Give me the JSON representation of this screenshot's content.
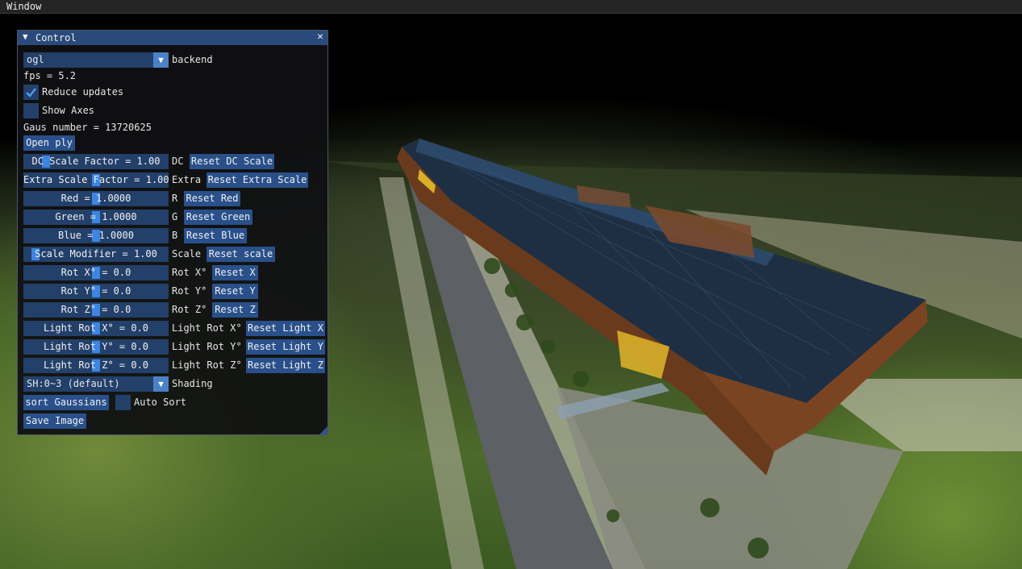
{
  "menubar": {
    "window_label": "Window"
  },
  "window": {
    "title": "Control"
  },
  "backend": {
    "selected": "ogl",
    "label": "backend"
  },
  "fps_text": "fps = 5.2",
  "reduce_updates": {
    "label": "Reduce updates",
    "checked": true
  },
  "show_axes": {
    "label": "Show Axes",
    "checked": false
  },
  "gaus_text": "Gaus number = 13720625",
  "open_ply": "Open ply",
  "sliders": [
    {
      "text": "DC Scale Factor = 1.00",
      "label": "DC",
      "reset": "Reset DC Scale",
      "value": 1.0,
      "min": 0.0,
      "max": 8.0
    },
    {
      "text": "Extra Scale Factor = 1.00",
      "label": "Extra",
      "reset": "Reset Extra Scale",
      "value": 1.0,
      "min": 0.0,
      "max": 2.0
    },
    {
      "text": "Red = 1.0000",
      "label": "R",
      "reset": "Reset Red",
      "value": 1.0,
      "min": 0.0,
      "max": 2.0
    },
    {
      "text": "Green = 1.0000",
      "label": "G",
      "reset": "Reset Green",
      "value": 1.0,
      "min": 0.0,
      "max": 2.0
    },
    {
      "text": "Blue = 1.0000",
      "label": "B",
      "reset": "Reset Blue",
      "value": 1.0,
      "min": 0.0,
      "max": 2.0
    },
    {
      "text": "Scale Modifier = 1.00",
      "label": "Scale",
      "reset": "Reset scale",
      "value": 1.0,
      "min": 0.0,
      "max": 20.0
    },
    {
      "text": "Rot X° = 0.0",
      "label": "Rot X°",
      "reset": "Reset X",
      "value": 0.0,
      "min": -180.0,
      "max": 180.0
    },
    {
      "text": "Rot Y° = 0.0",
      "label": "Rot Y°",
      "reset": "Reset Y",
      "value": 0.0,
      "min": -180.0,
      "max": 180.0
    },
    {
      "text": "Rot Z° = 0.0",
      "label": "Rot Z°",
      "reset": "Reset Z",
      "value": 0.0,
      "min": -180.0,
      "max": 180.0
    },
    {
      "text": "Light Rot X° = 0.0",
      "label": "Light Rot X°",
      "reset": "Reset Light X",
      "value": 0.0,
      "min": -180.0,
      "max": 180.0
    },
    {
      "text": "Light Rot Y° = 0.0",
      "label": "Light Rot Y°",
      "reset": "Reset Light Y",
      "value": 0.0,
      "min": -180.0,
      "max": 180.0
    },
    {
      "text": "Light Rot Z° = 0.0",
      "label": "Light Rot Z°",
      "reset": "Reset Light Z",
      "value": 0.0,
      "min": -180.0,
      "max": 180.0
    }
  ],
  "shading": {
    "selected": "SH:0~3 (default)",
    "label": "Shading"
  },
  "sort_gaussians": "sort Gaussians",
  "auto_sort": {
    "label": "Auto Sort",
    "checked": false
  },
  "save_image": "Save Image",
  "colors": {
    "title_bg": "#294a7a",
    "frame_bg": "#23406a",
    "button": "#29508a",
    "grab": "#3d85e0"
  }
}
